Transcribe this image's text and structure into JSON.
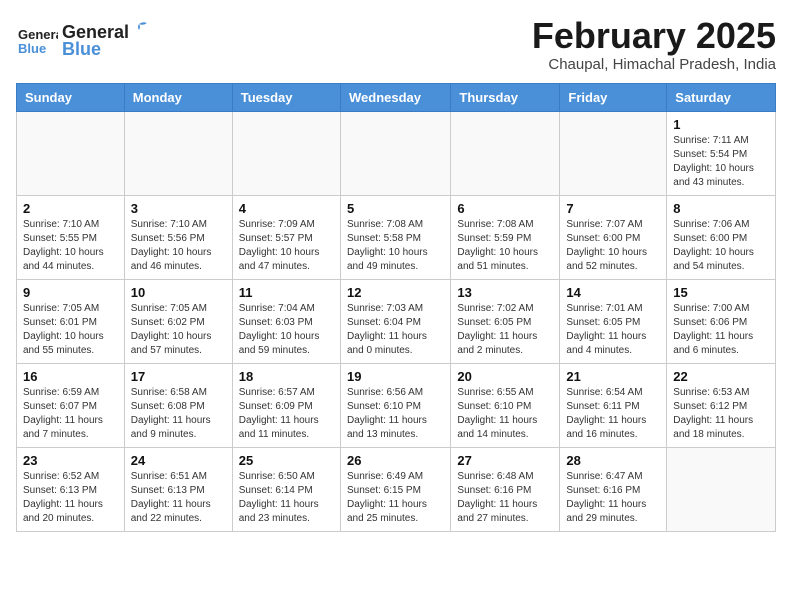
{
  "header": {
    "logo_general": "General",
    "logo_blue": "Blue",
    "month_title": "February 2025",
    "location": "Chaupal, Himachal Pradesh, India"
  },
  "weekdays": [
    "Sunday",
    "Monday",
    "Tuesday",
    "Wednesday",
    "Thursday",
    "Friday",
    "Saturday"
  ],
  "weeks": [
    [
      {
        "day": "",
        "info": ""
      },
      {
        "day": "",
        "info": ""
      },
      {
        "day": "",
        "info": ""
      },
      {
        "day": "",
        "info": ""
      },
      {
        "day": "",
        "info": ""
      },
      {
        "day": "",
        "info": ""
      },
      {
        "day": "1",
        "info": "Sunrise: 7:11 AM\nSunset: 5:54 PM\nDaylight: 10 hours and 43 minutes."
      }
    ],
    [
      {
        "day": "2",
        "info": "Sunrise: 7:10 AM\nSunset: 5:55 PM\nDaylight: 10 hours and 44 minutes."
      },
      {
        "day": "3",
        "info": "Sunrise: 7:10 AM\nSunset: 5:56 PM\nDaylight: 10 hours and 46 minutes."
      },
      {
        "day": "4",
        "info": "Sunrise: 7:09 AM\nSunset: 5:57 PM\nDaylight: 10 hours and 47 minutes."
      },
      {
        "day": "5",
        "info": "Sunrise: 7:08 AM\nSunset: 5:58 PM\nDaylight: 10 hours and 49 minutes."
      },
      {
        "day": "6",
        "info": "Sunrise: 7:08 AM\nSunset: 5:59 PM\nDaylight: 10 hours and 51 minutes."
      },
      {
        "day": "7",
        "info": "Sunrise: 7:07 AM\nSunset: 6:00 PM\nDaylight: 10 hours and 52 minutes."
      },
      {
        "day": "8",
        "info": "Sunrise: 7:06 AM\nSunset: 6:00 PM\nDaylight: 10 hours and 54 minutes."
      }
    ],
    [
      {
        "day": "9",
        "info": "Sunrise: 7:05 AM\nSunset: 6:01 PM\nDaylight: 10 hours and 55 minutes."
      },
      {
        "day": "10",
        "info": "Sunrise: 7:05 AM\nSunset: 6:02 PM\nDaylight: 10 hours and 57 minutes."
      },
      {
        "day": "11",
        "info": "Sunrise: 7:04 AM\nSunset: 6:03 PM\nDaylight: 10 hours and 59 minutes."
      },
      {
        "day": "12",
        "info": "Sunrise: 7:03 AM\nSunset: 6:04 PM\nDaylight: 11 hours and 0 minutes."
      },
      {
        "day": "13",
        "info": "Sunrise: 7:02 AM\nSunset: 6:05 PM\nDaylight: 11 hours and 2 minutes."
      },
      {
        "day": "14",
        "info": "Sunrise: 7:01 AM\nSunset: 6:05 PM\nDaylight: 11 hours and 4 minutes."
      },
      {
        "day": "15",
        "info": "Sunrise: 7:00 AM\nSunset: 6:06 PM\nDaylight: 11 hours and 6 minutes."
      }
    ],
    [
      {
        "day": "16",
        "info": "Sunrise: 6:59 AM\nSunset: 6:07 PM\nDaylight: 11 hours and 7 minutes."
      },
      {
        "day": "17",
        "info": "Sunrise: 6:58 AM\nSunset: 6:08 PM\nDaylight: 11 hours and 9 minutes."
      },
      {
        "day": "18",
        "info": "Sunrise: 6:57 AM\nSunset: 6:09 PM\nDaylight: 11 hours and 11 minutes."
      },
      {
        "day": "19",
        "info": "Sunrise: 6:56 AM\nSunset: 6:10 PM\nDaylight: 11 hours and 13 minutes."
      },
      {
        "day": "20",
        "info": "Sunrise: 6:55 AM\nSunset: 6:10 PM\nDaylight: 11 hours and 14 minutes."
      },
      {
        "day": "21",
        "info": "Sunrise: 6:54 AM\nSunset: 6:11 PM\nDaylight: 11 hours and 16 minutes."
      },
      {
        "day": "22",
        "info": "Sunrise: 6:53 AM\nSunset: 6:12 PM\nDaylight: 11 hours and 18 minutes."
      }
    ],
    [
      {
        "day": "23",
        "info": "Sunrise: 6:52 AM\nSunset: 6:13 PM\nDaylight: 11 hours and 20 minutes."
      },
      {
        "day": "24",
        "info": "Sunrise: 6:51 AM\nSunset: 6:13 PM\nDaylight: 11 hours and 22 minutes."
      },
      {
        "day": "25",
        "info": "Sunrise: 6:50 AM\nSunset: 6:14 PM\nDaylight: 11 hours and 23 minutes."
      },
      {
        "day": "26",
        "info": "Sunrise: 6:49 AM\nSunset: 6:15 PM\nDaylight: 11 hours and 25 minutes."
      },
      {
        "day": "27",
        "info": "Sunrise: 6:48 AM\nSunset: 6:16 PM\nDaylight: 11 hours and 27 minutes."
      },
      {
        "day": "28",
        "info": "Sunrise: 6:47 AM\nSunset: 6:16 PM\nDaylight: 11 hours and 29 minutes."
      },
      {
        "day": "",
        "info": ""
      }
    ]
  ]
}
